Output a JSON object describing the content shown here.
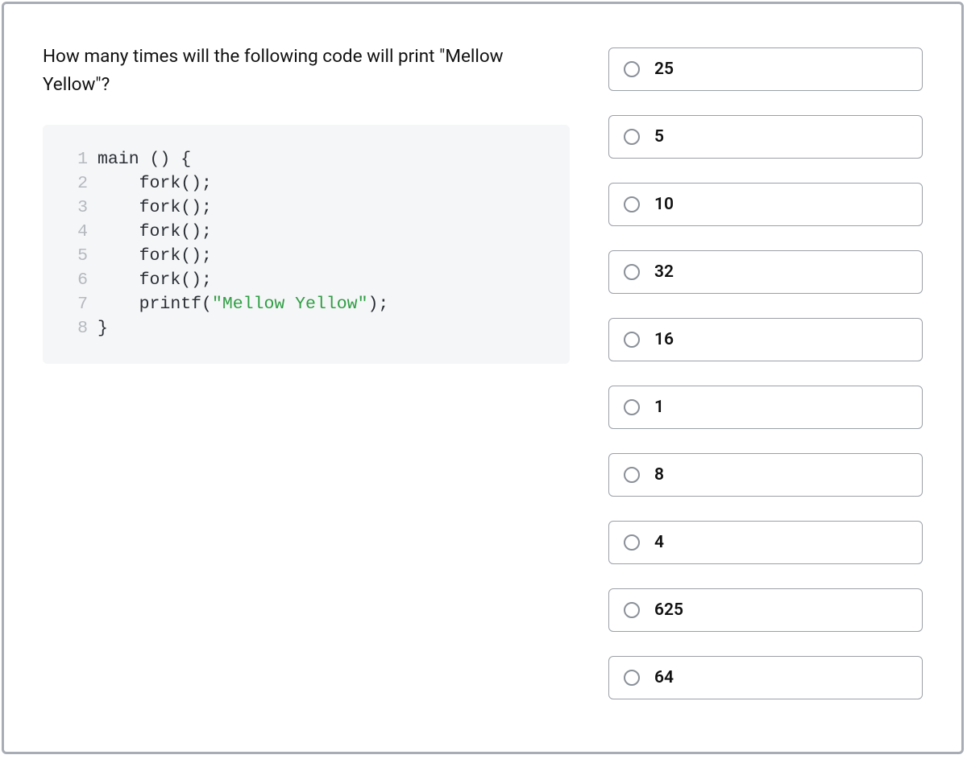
{
  "question": {
    "prompt": "How many times will the following code will print \"Mellow Yellow\"?"
  },
  "code": {
    "lines": [
      {
        "n": "1",
        "pre": "main () {",
        "str": "",
        "post": ""
      },
      {
        "n": "2",
        "pre": "    fork();",
        "str": "",
        "post": ""
      },
      {
        "n": "3",
        "pre": "    fork();",
        "str": "",
        "post": ""
      },
      {
        "n": "4",
        "pre": "    fork();",
        "str": "",
        "post": ""
      },
      {
        "n": "5",
        "pre": "    fork();",
        "str": "",
        "post": ""
      },
      {
        "n": "6",
        "pre": "    fork();",
        "str": "",
        "post": ""
      },
      {
        "n": "7",
        "pre": "    printf(",
        "str": "\"Mellow Yellow\"",
        "post": ");"
      },
      {
        "n": "8",
        "pre": "}",
        "str": "",
        "post": ""
      }
    ]
  },
  "options": [
    {
      "label": "25"
    },
    {
      "label": "5"
    },
    {
      "label": "10"
    },
    {
      "label": "32"
    },
    {
      "label": "16"
    },
    {
      "label": "1"
    },
    {
      "label": "8"
    },
    {
      "label": "4"
    },
    {
      "label": "625"
    },
    {
      "label": "64"
    }
  ]
}
